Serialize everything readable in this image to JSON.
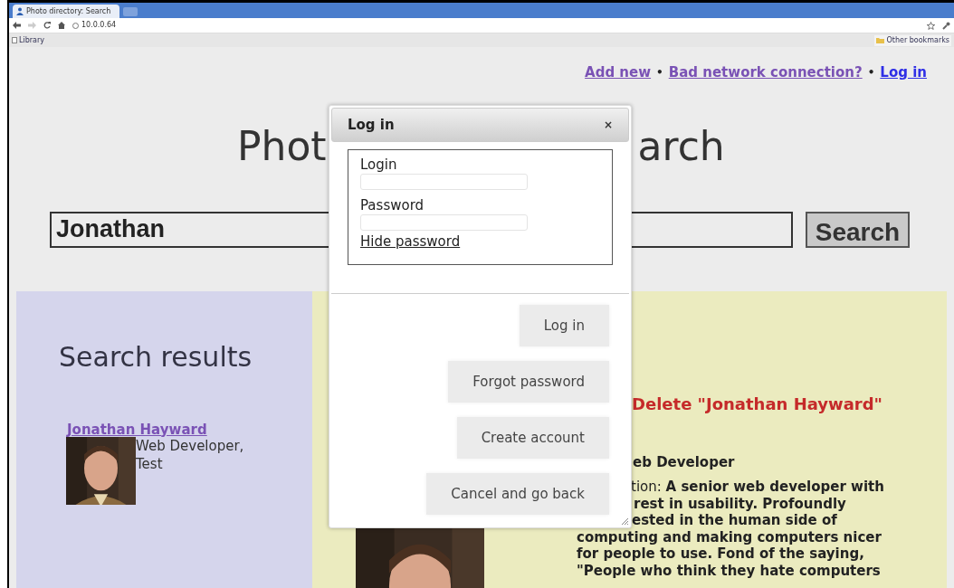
{
  "browser": {
    "tab_title": "Photo directory: Search",
    "url": "10.0.0.64",
    "bookmarks": [
      "Library"
    ],
    "other_bookmarks": "Other bookmarks"
  },
  "nav_links": [
    {
      "text": "Add new",
      "visited": true
    },
    {
      "text": "Bad network connection?",
      "visited": true
    },
    {
      "text": "Log in",
      "visited": false
    }
  ],
  "nav_separator": "•",
  "page_title_parts": [
    "Phot",
    "arch"
  ],
  "search": {
    "value": "Jonathan",
    "button": "Search"
  },
  "results": {
    "heading": "Search results",
    "items": [
      {
        "name": "Jonathan Hayward",
        "description": "Web Developer, Test"
      }
    ]
  },
  "detail": {
    "delete_link": "Delete \"Jonathan Hayward\"",
    "title_fragment": "eb Developer",
    "description_lines": [
      "tion: **A senior web developer with**",
      "**rest in usability. Profoundly**",
      "**ested in the human side of**",
      "**computing and making computers nicer**",
      "**for people to use. Fond of the saying,**",
      "**\"People who think they hate computers**"
    ]
  },
  "dialog": {
    "title": "Log in",
    "close": "×",
    "fields": [
      {
        "label": "Login"
      },
      {
        "label": "Password"
      }
    ],
    "toggle_link": "Hide password",
    "buttons": [
      "Log in",
      "Forgot password",
      "Create account",
      "Cancel and go back"
    ]
  }
}
